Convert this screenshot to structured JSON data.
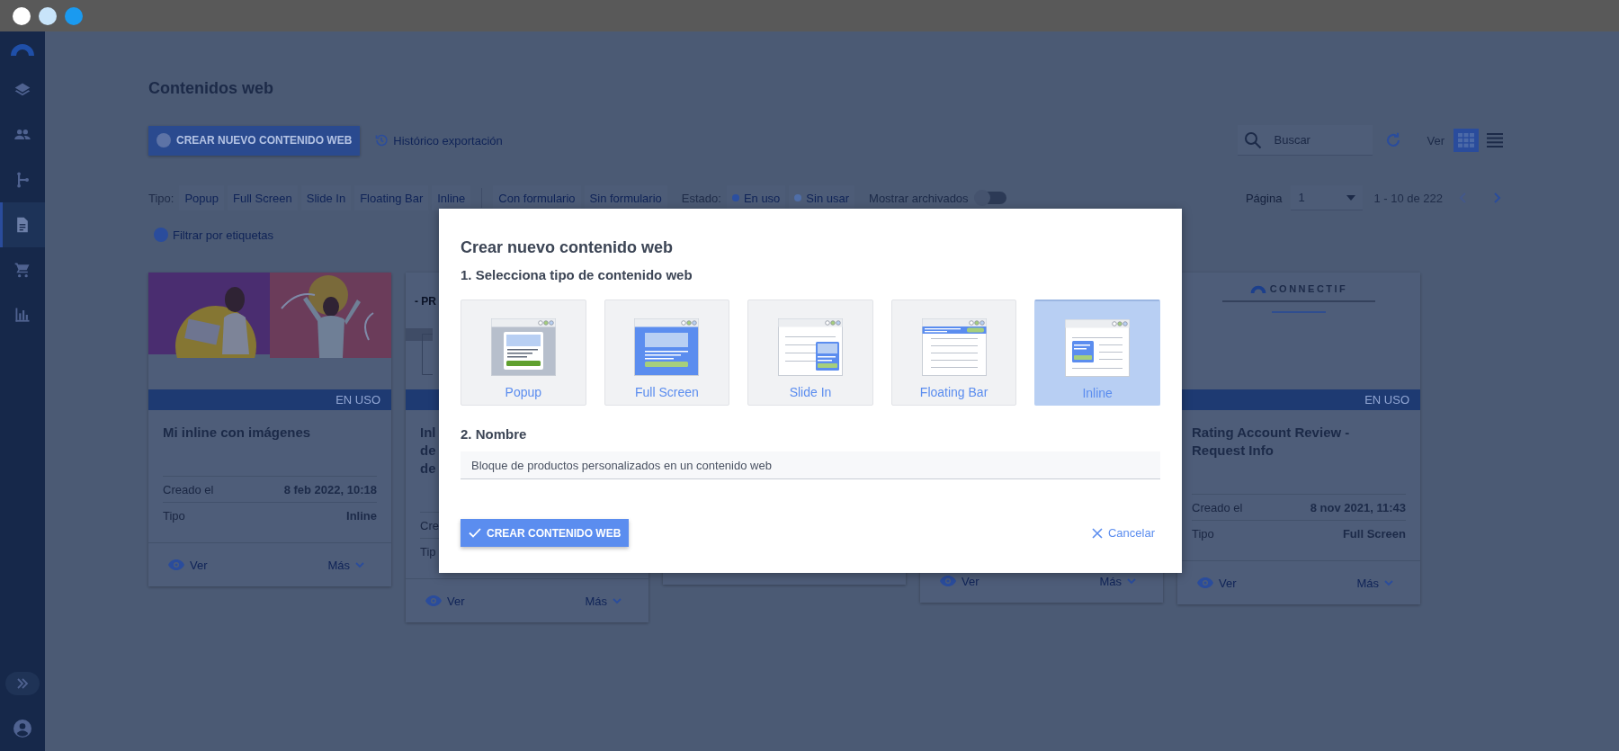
{
  "window_controls": [
    {
      "color": "#ffffff"
    },
    {
      "color": "#c8e4fa"
    },
    {
      "color": "#1a9af0"
    }
  ],
  "sidebar": {
    "items": [
      {
        "kind": "layers",
        "selected": false
      },
      {
        "kind": "people",
        "selected": false
      },
      {
        "kind": "flow",
        "selected": false
      },
      {
        "kind": "document",
        "selected": true
      },
      {
        "kind": "cart",
        "selected": false
      },
      {
        "kind": "chart",
        "selected": false
      }
    ]
  },
  "page_title": "Contenidos web",
  "toolbar": {
    "create_button": "CREAR NUEVO CONTENIDO WEB",
    "history_link": "Histórico exportación",
    "search": {
      "placeholder": "Buscar"
    },
    "view_label": "Ver",
    "views": [
      {
        "kind": "grid",
        "selected": true
      },
      {
        "kind": "list",
        "selected": false
      }
    ]
  },
  "filters": {
    "type_label": "Tipo:",
    "types": [
      {
        "label": "Popup"
      },
      {
        "label": "Full Screen"
      },
      {
        "label": "Slide In"
      },
      {
        "label": "Floating Bar"
      },
      {
        "label": "Inline"
      }
    ],
    "form_types": [
      {
        "label": "Con formulario"
      },
      {
        "label": "Sin formulario"
      }
    ],
    "state_label": "Estado:",
    "states": [
      {
        "label": "En uso",
        "color": "#2b4fa0"
      },
      {
        "label": "Sin usar",
        "color": "#4f6ea8"
      }
    ],
    "archived": {
      "label": "Mostrar archivados",
      "on": false
    },
    "tags_link": "Filtrar por etiquetas"
  },
  "pagination": {
    "label": "Página",
    "page": "1",
    "range": "1 - 10 de 222",
    "prev": {
      "disabled": true
    },
    "next": {
      "disabled": false
    }
  },
  "cards": [
    {
      "thumbnail": {
        "kind": "picture"
      },
      "status": "EN USO",
      "title_lines": [
        "Mi inline con imágenes"
      ],
      "fields": [
        {
          "label": "Creado el",
          "value": "8 feb 2022, 10:18"
        },
        {
          "label": "Tipo",
          "value": "Inline"
        }
      ],
      "actions": {
        "view": "Ver",
        "more": "Más"
      }
    },
    {
      "thumbnail": {
        "kind": "document",
        "text": "- PR"
      },
      "status_bar": true,
      "title_lines": [
        "Inl",
        "de",
        "de"
      ],
      "fields": [
        {
          "label": "Cre"
        },
        {
          "label": "Tip"
        }
      ],
      "actions": {
        "view": "Ver",
        "more": "Más"
      }
    },
    {
      "kind": "covered"
    },
    {
      "kind": "covered",
      "actions": {
        "view": "Ver",
        "more": "Más"
      }
    },
    {
      "thumbnail": {
        "kind": "logo",
        "text": "CONNECTIF"
      },
      "status": "EN USO",
      "title_lines": [
        "Rating Account Review -",
        "Request Info"
      ],
      "fields": [
        {
          "label": "Creado el",
          "value": "8 nov 2021, 11:43"
        },
        {
          "label": "Tipo",
          "value": "Full Screen"
        }
      ],
      "actions": {
        "view": "Ver",
        "more": "Más"
      }
    }
  ],
  "dialog": {
    "title": "Crear nuevo contenido web",
    "step_1": "1. Selecciona tipo de contenido web",
    "types": [
      {
        "kind": "popup",
        "label": "Popup",
        "selected": false
      },
      {
        "kind": "fullscreen",
        "label": "Full Screen",
        "selected": false
      },
      {
        "kind": "slidein",
        "label": "Slide In",
        "selected": false
      },
      {
        "kind": "floatingbar",
        "label": "Floating Bar",
        "selected": false
      },
      {
        "kind": "inline",
        "label": "Inline",
        "selected": true
      }
    ],
    "step_2": "2. Nombre",
    "name_field": {
      "value": "Bloque de productos personalizados en un contenido web"
    },
    "confirm_button": "CREAR CONTENIDO WEB",
    "cancel_button": "Cancelar"
  }
}
